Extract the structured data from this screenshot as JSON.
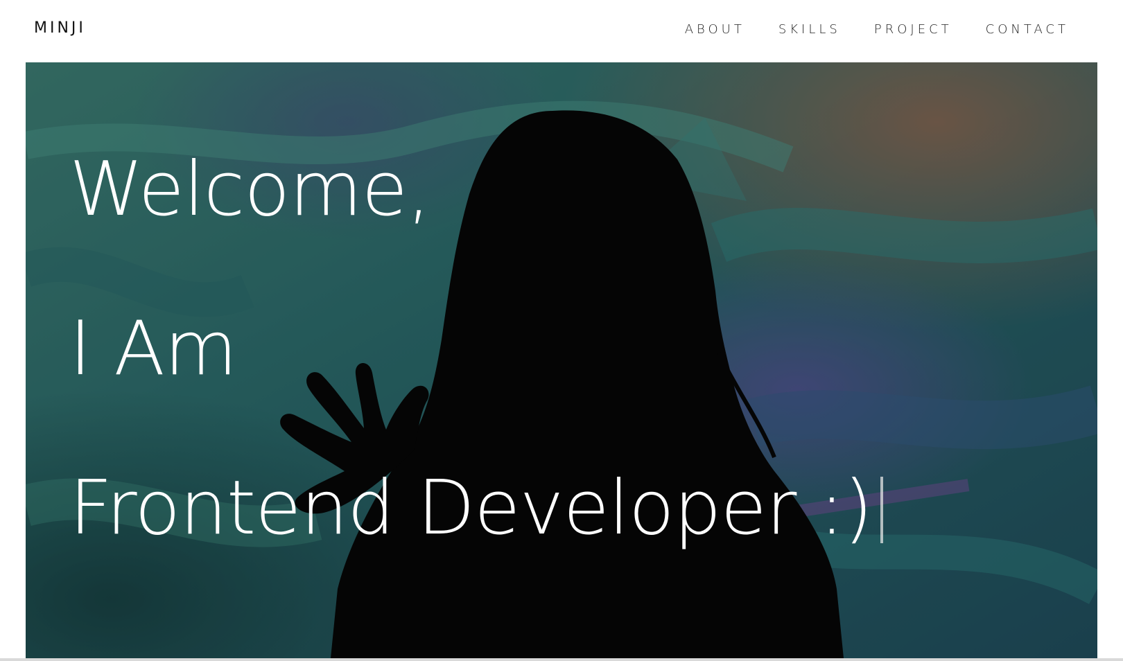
{
  "header": {
    "logo": "MINJI",
    "nav": [
      {
        "label": "ABOUT"
      },
      {
        "label": "SKILLS"
      },
      {
        "label": "PROJECT"
      },
      {
        "label": "CONTACT"
      }
    ]
  },
  "hero": {
    "line1": "Welcome,",
    "line2": "I Am",
    "line3": "Frontend Developer :)",
    "background_image": "silhouette-of-woman-waving-against-teal-projected-painting",
    "colors": {
      "text": "#ffffff",
      "overlay_teal": "#2f7f7a",
      "silhouette": "#050505"
    }
  }
}
